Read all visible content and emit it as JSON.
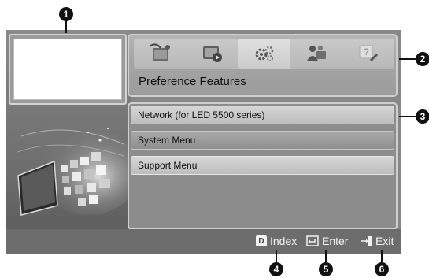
{
  "callouts": {
    "c1": "1",
    "c2": "2",
    "c3": "3",
    "c4": "4",
    "c5": "5",
    "c6": "6"
  },
  "header": {
    "title": "Preference Features",
    "category_icons": [
      "satellite-dish-icon",
      "tv-play-icon",
      "gears-icon",
      "support-people-icon",
      "help-icon"
    ],
    "active_index": 2
  },
  "menu": {
    "items": [
      {
        "label": "Network (for LED 5500 series)"
      },
      {
        "label": "System Menu"
      },
      {
        "label": "Support Menu"
      }
    ]
  },
  "bottom_bar": {
    "index_key": "D",
    "index_label": "Index",
    "enter_label": "Enter",
    "exit_label": "Exit"
  }
}
